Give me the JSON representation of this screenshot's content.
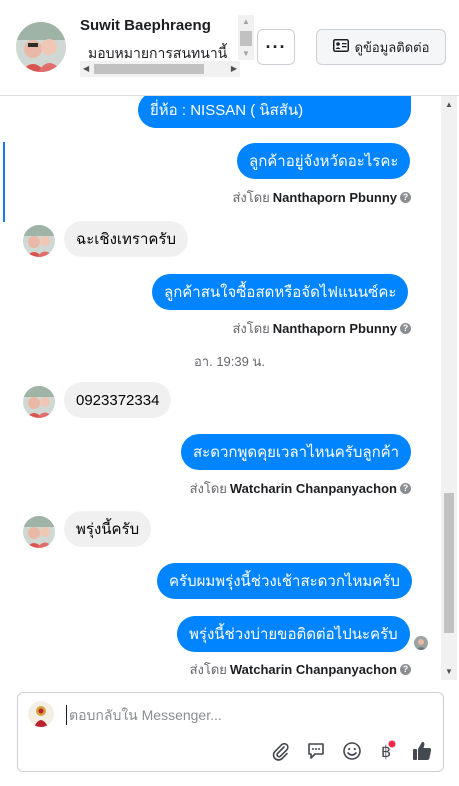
{
  "header": {
    "contact_name": "Suwit Baephraeng",
    "contact_subtitle": "มอบหมายการสนทนานี้",
    "more_label": "···",
    "contact_info_label": "ดูข้อมูลติดต่อ"
  },
  "messages": [
    {
      "text": "ยี่ห้อ : NISSAN ( นิสสัน)"
    },
    {
      "text": "ลูกค้าอยู่จังหวัดอะไรคะ"
    },
    {
      "text": "ฉะเชิงเทราครับ"
    },
    {
      "text": "ลูกค้าสนใจซื้อสดหรือจัดไฟแนนซ์คะ"
    },
    {
      "text": "0923372334"
    },
    {
      "text": "สะดวกพูดคุยเวลาไหนครับลูกค้า"
    },
    {
      "text": "พรุ่งนี้ครับ"
    },
    {
      "text": "ครับผมพรุ่งนี้ช่วงเช้าสะดวกไหมครับ"
    },
    {
      "text": "พรุ่งนี้ช่วงบ่ายขอติดต่อไปนะครับ"
    }
  ],
  "sent_by": {
    "prefix": "ส่งโดย",
    "agent1": "Nanthaporn Pbunny",
    "agent2": "Watcharin Chanpanyachon"
  },
  "timestamp": "อา. 19:39 น.",
  "composer": {
    "placeholder": "ตอบกลับใน Messenger..."
  },
  "colors": {
    "outgoing_bubble": "#0084ff",
    "incoming_bubble": "#f0f0f0",
    "accent": "#1877f2"
  },
  "icons": [
    "more-icon",
    "contact-card-icon",
    "attach-icon",
    "saved-replies-icon",
    "emoji-icon",
    "baht-payment-icon",
    "thumbs-up-icon",
    "help-icon"
  ]
}
